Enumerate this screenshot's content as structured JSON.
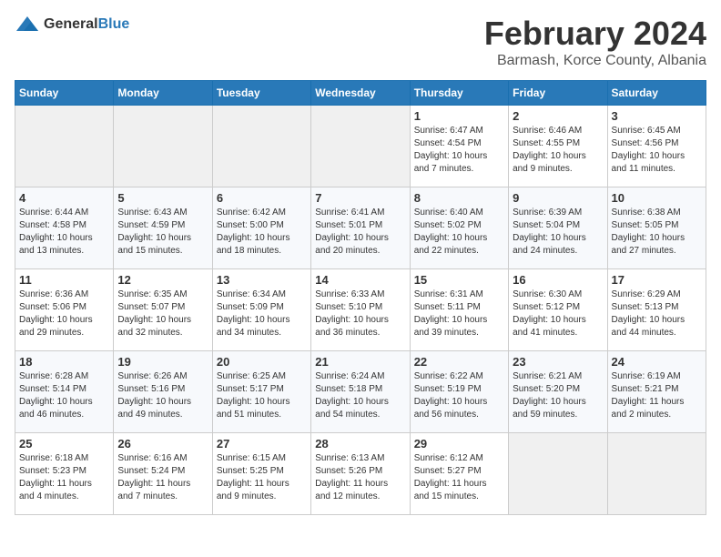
{
  "logo": {
    "general": "General",
    "blue": "Blue"
  },
  "header": {
    "title": "February 2024",
    "subtitle": "Barmash, Korce County, Albania"
  },
  "weekdays": [
    "Sunday",
    "Monday",
    "Tuesday",
    "Wednesday",
    "Thursday",
    "Friday",
    "Saturday"
  ],
  "weeks": [
    [
      {
        "day": "",
        "info": ""
      },
      {
        "day": "",
        "info": ""
      },
      {
        "day": "",
        "info": ""
      },
      {
        "day": "",
        "info": ""
      },
      {
        "day": "1",
        "info": "Sunrise: 6:47 AM\nSunset: 4:54 PM\nDaylight: 10 hours\nand 7 minutes."
      },
      {
        "day": "2",
        "info": "Sunrise: 6:46 AM\nSunset: 4:55 PM\nDaylight: 10 hours\nand 9 minutes."
      },
      {
        "day": "3",
        "info": "Sunrise: 6:45 AM\nSunset: 4:56 PM\nDaylight: 10 hours\nand 11 minutes."
      }
    ],
    [
      {
        "day": "4",
        "info": "Sunrise: 6:44 AM\nSunset: 4:58 PM\nDaylight: 10 hours\nand 13 minutes."
      },
      {
        "day": "5",
        "info": "Sunrise: 6:43 AM\nSunset: 4:59 PM\nDaylight: 10 hours\nand 15 minutes."
      },
      {
        "day": "6",
        "info": "Sunrise: 6:42 AM\nSunset: 5:00 PM\nDaylight: 10 hours\nand 18 minutes."
      },
      {
        "day": "7",
        "info": "Sunrise: 6:41 AM\nSunset: 5:01 PM\nDaylight: 10 hours\nand 20 minutes."
      },
      {
        "day": "8",
        "info": "Sunrise: 6:40 AM\nSunset: 5:02 PM\nDaylight: 10 hours\nand 22 minutes."
      },
      {
        "day": "9",
        "info": "Sunrise: 6:39 AM\nSunset: 5:04 PM\nDaylight: 10 hours\nand 24 minutes."
      },
      {
        "day": "10",
        "info": "Sunrise: 6:38 AM\nSunset: 5:05 PM\nDaylight: 10 hours\nand 27 minutes."
      }
    ],
    [
      {
        "day": "11",
        "info": "Sunrise: 6:36 AM\nSunset: 5:06 PM\nDaylight: 10 hours\nand 29 minutes."
      },
      {
        "day": "12",
        "info": "Sunrise: 6:35 AM\nSunset: 5:07 PM\nDaylight: 10 hours\nand 32 minutes."
      },
      {
        "day": "13",
        "info": "Sunrise: 6:34 AM\nSunset: 5:09 PM\nDaylight: 10 hours\nand 34 minutes."
      },
      {
        "day": "14",
        "info": "Sunrise: 6:33 AM\nSunset: 5:10 PM\nDaylight: 10 hours\nand 36 minutes."
      },
      {
        "day": "15",
        "info": "Sunrise: 6:31 AM\nSunset: 5:11 PM\nDaylight: 10 hours\nand 39 minutes."
      },
      {
        "day": "16",
        "info": "Sunrise: 6:30 AM\nSunset: 5:12 PM\nDaylight: 10 hours\nand 41 minutes."
      },
      {
        "day": "17",
        "info": "Sunrise: 6:29 AM\nSunset: 5:13 PM\nDaylight: 10 hours\nand 44 minutes."
      }
    ],
    [
      {
        "day": "18",
        "info": "Sunrise: 6:28 AM\nSunset: 5:14 PM\nDaylight: 10 hours\nand 46 minutes."
      },
      {
        "day": "19",
        "info": "Sunrise: 6:26 AM\nSunset: 5:16 PM\nDaylight: 10 hours\nand 49 minutes."
      },
      {
        "day": "20",
        "info": "Sunrise: 6:25 AM\nSunset: 5:17 PM\nDaylight: 10 hours\nand 51 minutes."
      },
      {
        "day": "21",
        "info": "Sunrise: 6:24 AM\nSunset: 5:18 PM\nDaylight: 10 hours\nand 54 minutes."
      },
      {
        "day": "22",
        "info": "Sunrise: 6:22 AM\nSunset: 5:19 PM\nDaylight: 10 hours\nand 56 minutes."
      },
      {
        "day": "23",
        "info": "Sunrise: 6:21 AM\nSunset: 5:20 PM\nDaylight: 10 hours\nand 59 minutes."
      },
      {
        "day": "24",
        "info": "Sunrise: 6:19 AM\nSunset: 5:21 PM\nDaylight: 11 hours\nand 2 minutes."
      }
    ],
    [
      {
        "day": "25",
        "info": "Sunrise: 6:18 AM\nSunset: 5:23 PM\nDaylight: 11 hours\nand 4 minutes."
      },
      {
        "day": "26",
        "info": "Sunrise: 6:16 AM\nSunset: 5:24 PM\nDaylight: 11 hours\nand 7 minutes."
      },
      {
        "day": "27",
        "info": "Sunrise: 6:15 AM\nSunset: 5:25 PM\nDaylight: 11 hours\nand 9 minutes."
      },
      {
        "day": "28",
        "info": "Sunrise: 6:13 AM\nSunset: 5:26 PM\nDaylight: 11 hours\nand 12 minutes."
      },
      {
        "day": "29",
        "info": "Sunrise: 6:12 AM\nSunset: 5:27 PM\nDaylight: 11 hours\nand 15 minutes."
      },
      {
        "day": "",
        "info": ""
      },
      {
        "day": "",
        "info": ""
      }
    ]
  ]
}
